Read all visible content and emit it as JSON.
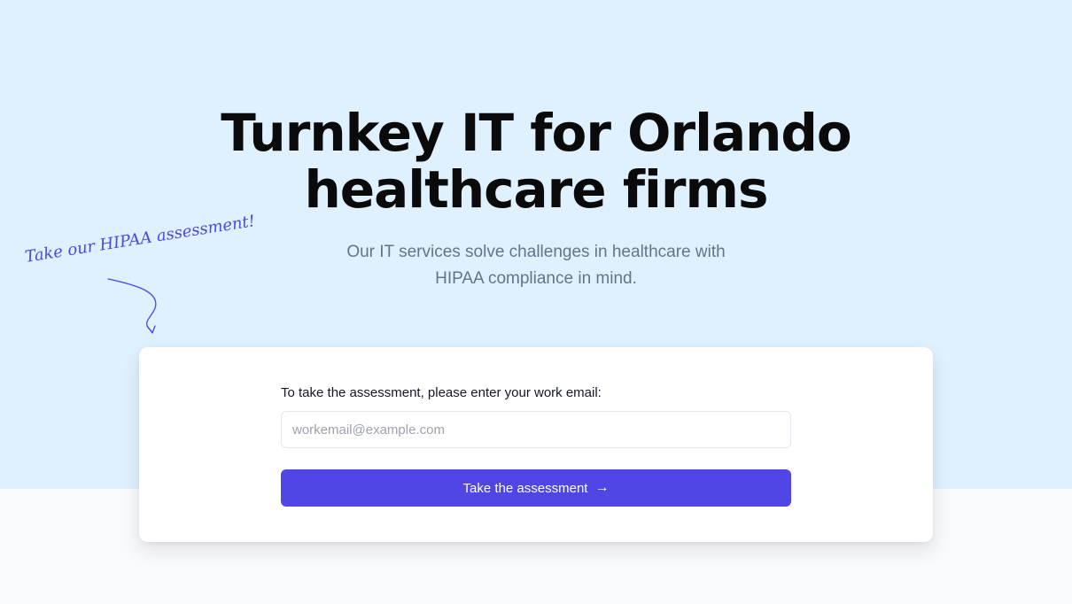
{
  "hero": {
    "title_line1": "Turnkey IT for Orlando",
    "title_line2": "healthcare firms",
    "subtitle_line1": "Our IT services solve challenges in healthcare with",
    "subtitle_line2": "HIPAA compliance in mind.",
    "annotation": "Take our HIPAA assessment!"
  },
  "form": {
    "label": "To take the assessment, please enter your work email:",
    "email_placeholder": "workemail@example.com",
    "email_value": "",
    "submit_label": "Take the assessment",
    "submit_icon": "arrow-right-icon",
    "submit_icon_glyph": "→"
  },
  "colors": {
    "hero_background": "#dff0fe",
    "page_background": "#f8fafc",
    "accent": "#4f46e5",
    "title": "#0a0a0a",
    "subtitle": "#64748b"
  }
}
